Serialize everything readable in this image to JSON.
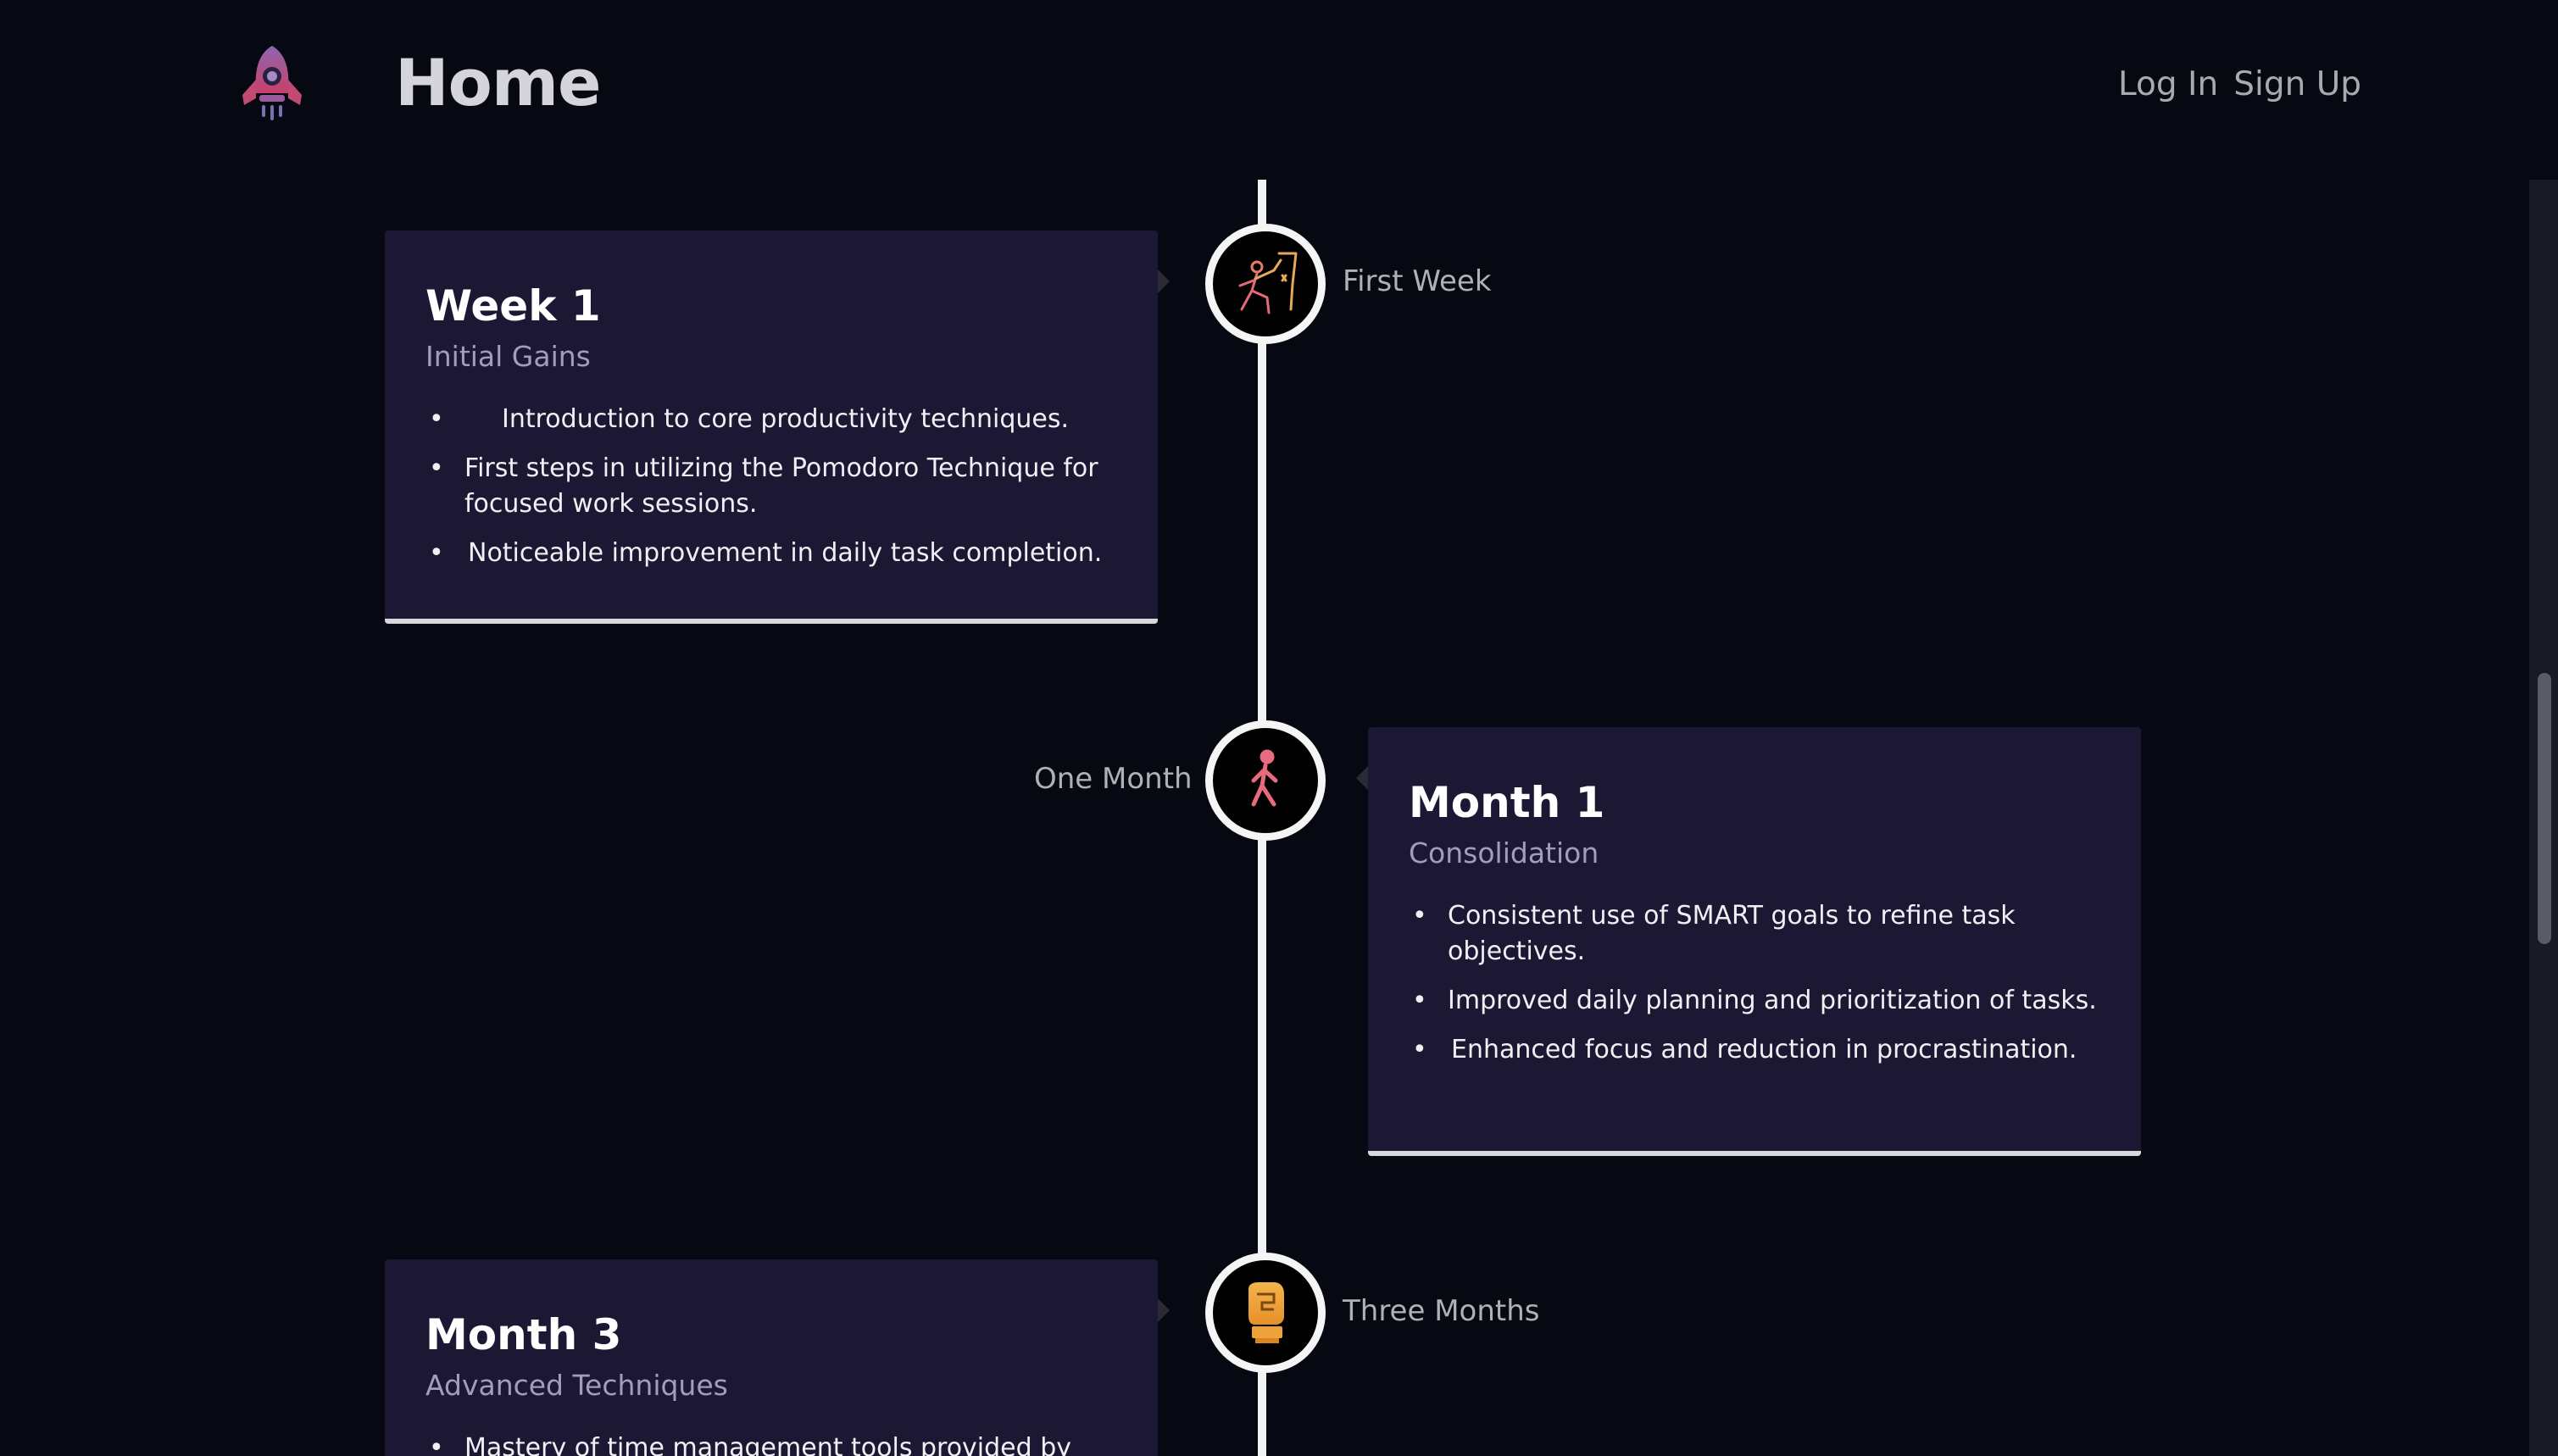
{
  "header": {
    "logo_icon": "rocket-icon",
    "title": "Home",
    "login_label": "Log In",
    "signup_label": "Sign Up"
  },
  "colors": {
    "background": "#060812",
    "card": "#1c1833",
    "subtitle": "#a39cbf",
    "timeline": "#f2f2f2"
  },
  "timeline": [
    {
      "label": "First Week",
      "icon": "climber-icon",
      "title": "Week 1",
      "subtitle": "Initial Gains",
      "points": [
        "Introduction to core productivity techniques.",
        "First steps in utilizing the Pomodoro Technique for focused work sessions.",
        "Noticeable improvement in daily task completion."
      ]
    },
    {
      "label": "One Month",
      "icon": "walking-icon",
      "title": "Month 1",
      "subtitle": "Consolidation",
      "points": [
        "Consistent use of SMART goals to refine task objectives.",
        "Improved daily planning and prioritization of tasks.",
        "Enhanced focus and reduction in procrastination."
      ]
    },
    {
      "label": "Three Months",
      "icon": "boxing-glove-icon",
      "title": "Month 3",
      "subtitle": "Advanced Techniques",
      "points": [
        "Mastery of time management tools provided by"
      ]
    }
  ]
}
